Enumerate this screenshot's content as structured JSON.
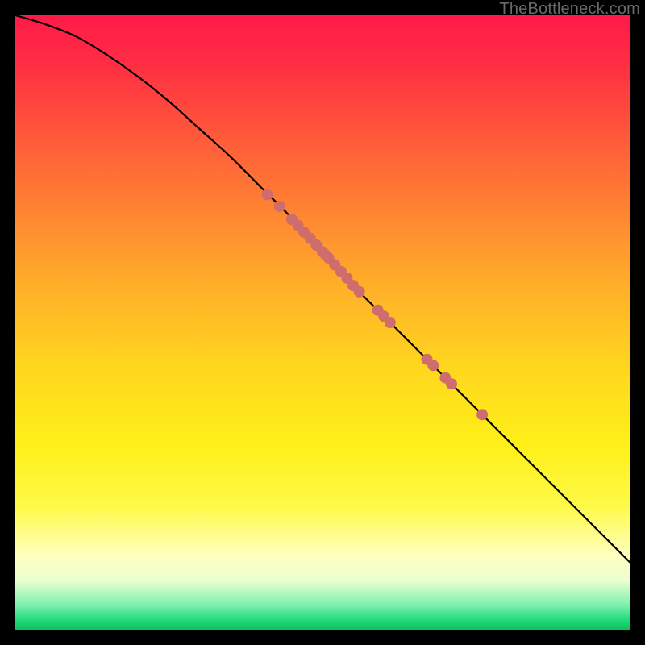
{
  "watermark": "TheBottleneck.com",
  "chart_data": {
    "type": "line",
    "title": "",
    "xlabel": "",
    "ylabel": "",
    "xlim": [
      0,
      100
    ],
    "ylim": [
      0,
      100
    ],
    "grid": false,
    "series": [
      {
        "name": "curve",
        "x": [
          0,
          5,
          10,
          15,
          20,
          25,
          30,
          35,
          40,
          45,
          50,
          55,
          60,
          65,
          70,
          75,
          80,
          85,
          90,
          95,
          100
        ],
        "y": [
          100,
          98.5,
          96.5,
          93.5,
          90.0,
          86.0,
          81.5,
          77.0,
          72.0,
          67.0,
          61.5,
          56.0,
          51.0,
          46.0,
          41.0,
          36.0,
          31.0,
          26.0,
          21.0,
          16.0,
          11.0
        ]
      },
      {
        "name": "cluster-points",
        "x": [
          41,
          43,
          45,
          46,
          47,
          48,
          49,
          50,
          50.5,
          51,
          52,
          53,
          54,
          55,
          56,
          59,
          60,
          61,
          67,
          68,
          70,
          71,
          76
        ],
        "y": [
          70.8,
          68.9,
          66.8,
          65.8,
          64.7,
          63.7,
          62.6,
          61.5,
          61.0,
          60.5,
          59.4,
          58.3,
          57.2,
          56.0,
          55.0,
          52.0,
          51.0,
          50.0,
          44.0,
          43.0,
          41.0,
          40.0,
          35.0
        ]
      }
    ],
    "colors": {
      "curve": "#000000",
      "points": "#cf6d6d"
    }
  }
}
